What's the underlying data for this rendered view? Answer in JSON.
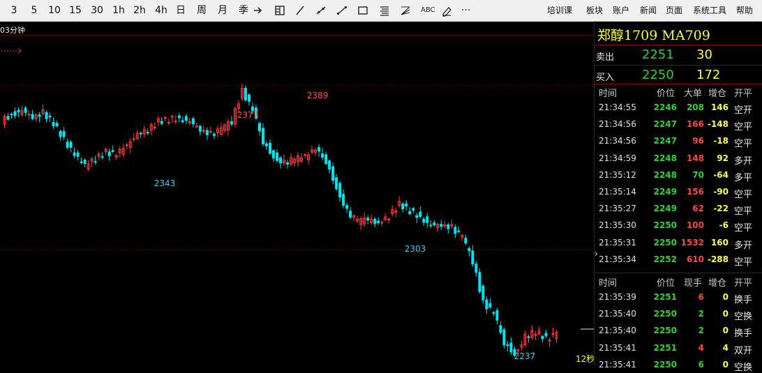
{
  "toolbar": {
    "periods": [
      "3",
      "5",
      "10",
      "15",
      "30",
      "1h",
      "2h",
      "4h",
      "日",
      "周",
      "月",
      "季"
    ],
    "tools": [
      "arrow-icon",
      "layout-icon",
      "line-icon",
      "ray-icon",
      "diagonal-icon",
      "rectangle-icon",
      "text-align-icon",
      "fan-icon",
      "text-tool-icon",
      "eraser-icon",
      "more-icon"
    ],
    "abc_label": "ABC",
    "more_label": "···",
    "menu": [
      "培训课",
      "板块",
      "账户",
      "新闻",
      "页面",
      "系统工具",
      "帮助"
    ]
  },
  "chart": {
    "period_label": "03分钟",
    "timer_label": "12秒",
    "annotations": [
      {
        "label": "2389",
        "color": "#ff5050"
      },
      {
        "label": "2377",
        "color": "#ff5050"
      },
      {
        "label": "2343",
        "color": "#4ec9e8"
      },
      {
        "label": "2303",
        "color": "#4ec9e8"
      },
      {
        "label": "2237",
        "color": "#4ec9e8"
      }
    ],
    "colors": {
      "up": "#ff3b3b",
      "down": "#00e5ee",
      "grid": "#8b0000"
    }
  },
  "chart_data": {
    "type": "candlestick",
    "title": "",
    "period": "03分钟",
    "high_marks": [
      2389,
      2377
    ],
    "low_marks": [
      2343,
      2303,
      2237
    ],
    "close_path": [
      2366,
      2370,
      2372,
      2369,
      2371,
      2365,
      2356,
      2347,
      2341,
      2345,
      2349,
      2347,
      2353,
      2358,
      2361,
      2366,
      2367,
      2368,
      2366,
      2362,
      2359,
      2361,
      2366,
      2383,
      2372,
      2355,
      2347,
      2343,
      2345,
      2346,
      2350,
      2344,
      2330,
      2316,
      2310,
      2311,
      2308,
      2313,
      2320,
      2316,
      2313,
      2308,
      2309,
      2307,
      2301,
      2288,
      2265,
      2259,
      2243,
      2237,
      2246,
      2249,
      2245,
      2247
    ]
  },
  "quote": {
    "title": "郑醇1709  MA709",
    "sell_label": "卖出",
    "sell_price": "2251",
    "sell_vol": "30",
    "buy_label": "买入",
    "buy_price": "2250",
    "buy_vol": "172"
  },
  "trades1": {
    "headers": [
      "时间",
      "价位",
      "大单",
      "增仓",
      "开平"
    ],
    "rows": [
      {
        "time": "21:34:55",
        "price": "2246",
        "vol": "208",
        "chg": "146",
        "type": "空开",
        "vc": "#2fd32f",
        "cc": "#ffff44"
      },
      {
        "time": "21:34:56",
        "price": "2247",
        "vol": "166",
        "chg": "-148",
        "type": "空平",
        "vc": "#ff4444",
        "cc": "#ffff44"
      },
      {
        "time": "21:34:56",
        "price": "2247",
        "vol": "96",
        "chg": "-18",
        "type": "空平",
        "vc": "#ff4444",
        "cc": "#ffff44"
      },
      {
        "time": "21:34:59",
        "price": "2248",
        "vol": "148",
        "chg": "92",
        "type": "多开",
        "vc": "#ff4444",
        "cc": "#ffff44"
      },
      {
        "time": "21:35:12",
        "price": "2248",
        "vol": "70",
        "chg": "-64",
        "type": "多平",
        "vc": "#2fd32f",
        "cc": "#ffff44"
      },
      {
        "time": "21:35:14",
        "price": "2249",
        "vol": "156",
        "chg": "-90",
        "type": "空平",
        "vc": "#ff4444",
        "cc": "#ffff44"
      },
      {
        "time": "21:35:27",
        "price": "2249",
        "vol": "62",
        "chg": "-22",
        "type": "空平",
        "vc": "#ff4444",
        "cc": "#ffff44"
      },
      {
        "time": "21:35:30",
        "price": "2250",
        "vol": "100",
        "chg": "-6",
        "type": "空平",
        "vc": "#ff4444",
        "cc": "#ffff44"
      },
      {
        "time": "21:35:31",
        "price": "2250",
        "vol": "1532",
        "chg": "160",
        "type": "多开",
        "vc": "#ff4444",
        "cc": "#ffff44"
      },
      {
        "time": "21:35:34",
        "price": "2252",
        "vol": "610",
        "chg": "-288",
        "type": "空平",
        "vc": "#ff4444",
        "cc": "#ffff44"
      }
    ]
  },
  "trades2": {
    "headers": [
      "时间",
      "价位",
      "现手",
      "增仓",
      "开平"
    ],
    "rows": [
      {
        "time": "21:35:39",
        "price": "2251",
        "vol": "6",
        "chg": "0",
        "type": "换手",
        "vc": "#ff4444",
        "cc": "#ffff44"
      },
      {
        "time": "21:35:40",
        "price": "2250",
        "vol": "2",
        "chg": "0",
        "type": "空换",
        "vc": "#2fd32f",
        "cc": "#ffff44"
      },
      {
        "time": "21:35:40",
        "price": "2250",
        "vol": "2",
        "chg": "0",
        "type": "换手",
        "vc": "#2fd32f",
        "cc": "#ffff44"
      },
      {
        "time": "21:35:41",
        "price": "2251",
        "vol": "4",
        "chg": "4",
        "type": "双开",
        "vc": "#ff4444",
        "cc": "#ffff44"
      },
      {
        "time": "21:35:41",
        "price": "2250",
        "vol": "6",
        "chg": "0",
        "type": "空换",
        "vc": "#2fd32f",
        "cc": "#ffff44"
      }
    ]
  }
}
